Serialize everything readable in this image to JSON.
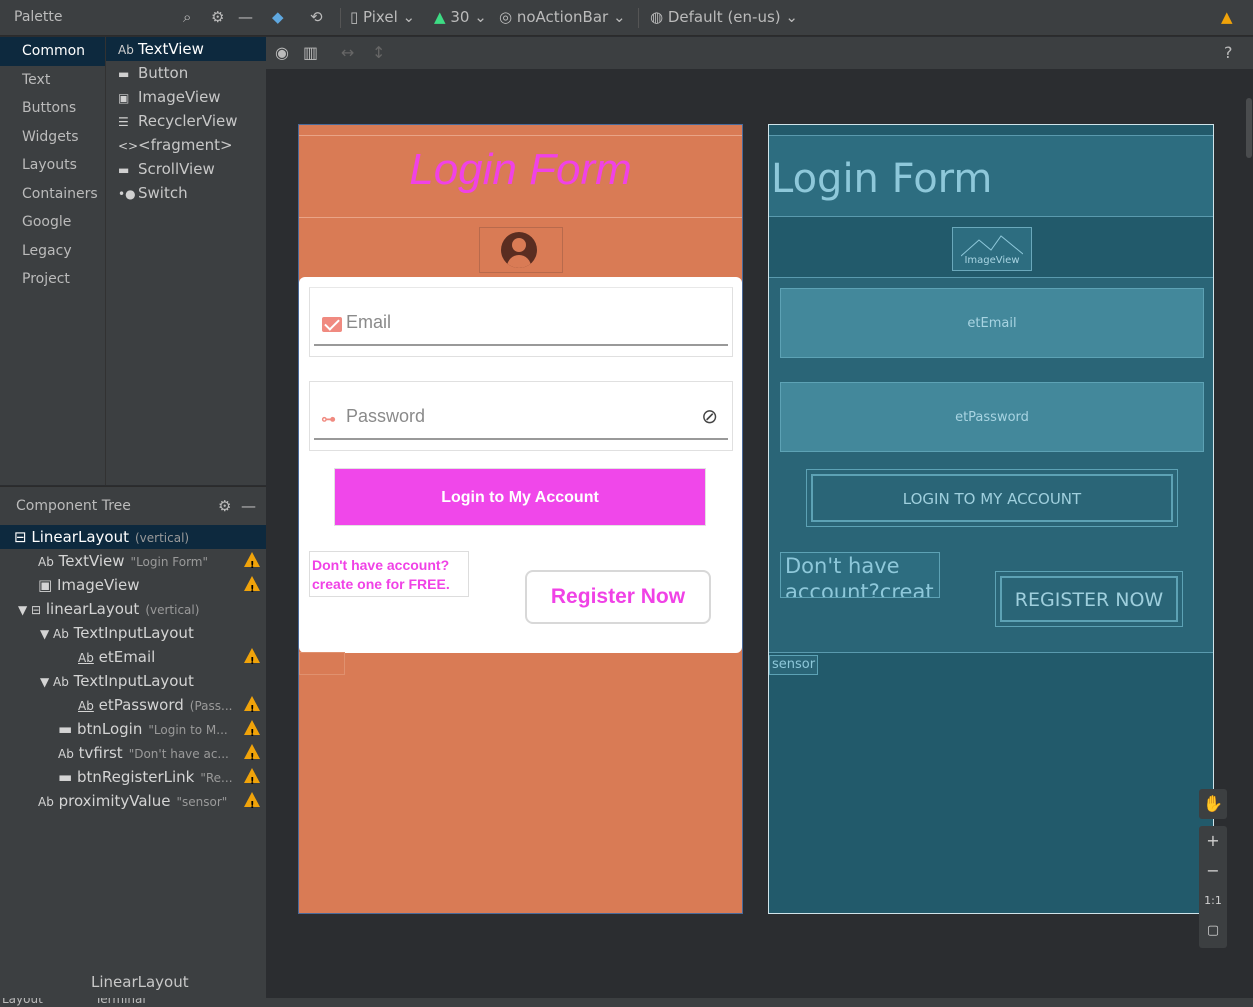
{
  "toolbar": {
    "palette_title": "Palette",
    "device": "Pixel",
    "api": "30",
    "theme": "noActionBar",
    "locale": "Default (en-us)"
  },
  "palette": {
    "categories": [
      "Common",
      "Text",
      "Buttons",
      "Widgets",
      "Layouts",
      "Containers",
      "Google",
      "Legacy",
      "Project"
    ],
    "items": [
      {
        "glyph": "Ab",
        "label": "TextView"
      },
      {
        "glyph": "▬",
        "label": "Button"
      },
      {
        "glyph": "▣",
        "label": "ImageView"
      },
      {
        "glyph": "☰",
        "label": "RecyclerView"
      },
      {
        "glyph": "<>",
        "label": "<fragment>"
      },
      {
        "glyph": "▬",
        "label": "ScrollView"
      },
      {
        "glyph": "•●",
        "label": "Switch"
      }
    ]
  },
  "tree": {
    "title": "Component Tree",
    "nodes": [
      {
        "glyph": "⊟",
        "label": "LinearLayout",
        "sub": "(vertical)"
      },
      {
        "glyph": "Ab",
        "label": "TextView",
        "sub": "\"Login Form\""
      },
      {
        "glyph": "▣",
        "label": "ImageView",
        "sub": ""
      },
      {
        "glyph": "▼ ⊟",
        "label": "linearLayout",
        "sub": "(vertical)"
      },
      {
        "glyph": "▼ Ab",
        "label": "TextInputLayout",
        "sub": ""
      },
      {
        "glyph": "Ab",
        "label": "etEmail",
        "sub": ""
      },
      {
        "glyph": "▼ Ab",
        "label": "TextInputLayout",
        "sub": ""
      },
      {
        "glyph": "Ab",
        "label": "etPassword",
        "sub": "(Pass..."
      },
      {
        "glyph": "▬",
        "label": "btnLogin",
        "sub": "\"Login to M..."
      },
      {
        "glyph": "Ab",
        "label": "tvfirst",
        "sub": "\"Don't have ac..."
      },
      {
        "glyph": "▬",
        "label": "btnRegisterLink",
        "sub": "\"Re..."
      },
      {
        "glyph": "Ab",
        "label": "proximityValue",
        "sub": "\"sensor\""
      }
    ]
  },
  "bottom": {
    "selected": "LinearLayout",
    "status_left": "Layout",
    "status_right": "Terminal"
  },
  "design": {
    "title": "Login Form",
    "email_hint": "Email",
    "password_hint": "Password",
    "login_button": "Login to My Account",
    "no_account_line1": "Don't have account?",
    "no_account_line2": "create one for FREE.",
    "register_button": "Register Now"
  },
  "blueprint": {
    "title": "Login Form",
    "image_label": "ImageView",
    "email_id": "etEmail",
    "password_id": "etPassword",
    "login_button": "LOGIN TO MY ACCOUNT",
    "no_account": "Don't have account?creat",
    "register_button": "REGISTER NOW",
    "sensor": "sensor"
  },
  "zoom": {
    "plus": "+",
    "minus": "−",
    "one_to_one": "1:1"
  },
  "colors": {
    "design_bg": "#d97b55",
    "accent_pink": "#f042e6",
    "blueprint_bg": "#225a6b",
    "warning": "#f0a30a"
  }
}
